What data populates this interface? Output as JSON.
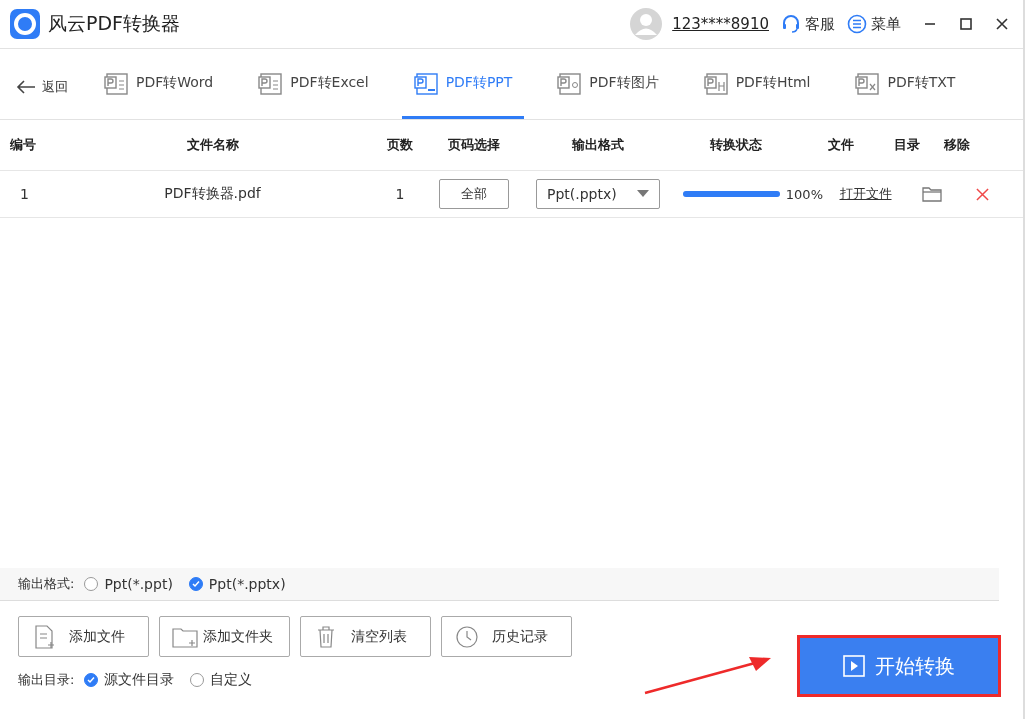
{
  "window": {
    "title": "风云PDF转换器",
    "user": "123****8910",
    "service": "客服",
    "menu": "菜单"
  },
  "nav": {
    "back": "返回",
    "tabs": [
      {
        "label": "PDF转Word",
        "selected": false,
        "kind": "word"
      },
      {
        "label": "PDF转Excel",
        "selected": false,
        "kind": "excel"
      },
      {
        "label": "PDF转PPT",
        "selected": true,
        "kind": "ppt"
      },
      {
        "label": "PDF转图片",
        "selected": false,
        "kind": "image"
      },
      {
        "label": "PDF转Html",
        "selected": false,
        "kind": "html"
      },
      {
        "label": "PDF转TXT",
        "selected": false,
        "kind": "txt"
      }
    ]
  },
  "table": {
    "columns": [
      "编号",
      "文件名称",
      "页数",
      "页码选择",
      "输出格式",
      "转换状态",
      "文件",
      "目录",
      "移除"
    ],
    "rows": [
      {
        "index": "1",
        "name": "PDF转换器.pdf",
        "pages": "1",
        "range": "全部",
        "format": "Ppt(.pptx)",
        "level": 1,
        "reading": "100%",
        "open": "打开文件"
      }
    ]
  },
  "output_format": {
    "label": "输出格式:",
    "options": [
      {
        "label": "Ppt(*.ppt)",
        "selected": false
      },
      {
        "label": "Ppt(*.pptx)",
        "selected": true
      }
    ]
  },
  "buttons": [
    {
      "label": "添加文件",
      "kind": "file"
    },
    {
      "label": "添加文件夹",
      "kind": "folder"
    },
    {
      "label": "清空列表",
      "kind": "trash"
    },
    {
      "label": "历史记录",
      "kind": "clock"
    }
  ],
  "output_dir": {
    "label": "输出目录:",
    "options": [
      {
        "label": "源文件目录",
        "selected": true
      },
      {
        "label": "自定义",
        "selected": false
      }
    ]
  },
  "start": {
    "label": "开始转换",
    "highlighted": true
  }
}
